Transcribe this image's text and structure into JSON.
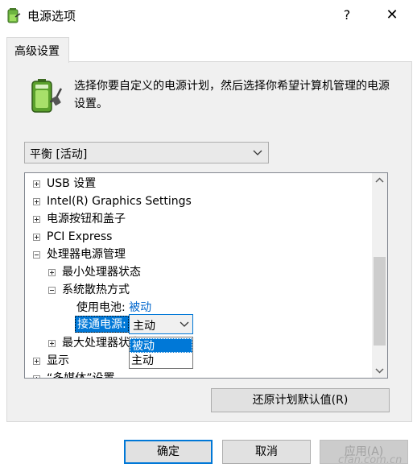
{
  "window": {
    "title": "电源选项",
    "help_label": "?",
    "close_label": "✕"
  },
  "tab": {
    "label": "高级设置"
  },
  "description": "选择你要自定义的电源计划，然后选择你希望计算机管理的电源设置。",
  "plan_select": {
    "value": "平衡 [活动]"
  },
  "tree": {
    "items": [
      {
        "label": "USB 设置",
        "expander": "plus"
      },
      {
        "label": "Intel(R) Graphics Settings",
        "expander": "plus"
      },
      {
        "label": "电源按钮和盖子",
        "expander": "plus"
      },
      {
        "label": "PCI Express",
        "expander": "plus"
      },
      {
        "label": "处理器电源管理",
        "expander": "minus"
      },
      {
        "label": "最小处理器状态",
        "expander": "plus"
      },
      {
        "label": "系统散热方式",
        "expander": "minus"
      },
      {
        "label": "使用电池:",
        "value": "被动"
      },
      {
        "label": "接通电源:",
        "value": "主动"
      },
      {
        "label": "最大处理器状态",
        "expander": "plus"
      },
      {
        "label": "显示",
        "expander": "plus"
      },
      {
        "label": "“多媒体”设置",
        "expander": "plus"
      }
    ]
  },
  "dropdown": {
    "options": [
      "被动",
      "主动"
    ],
    "selected": "被动"
  },
  "buttons": {
    "restore": "还原计划默认值(R)",
    "ok": "确定",
    "cancel": "取消",
    "apply": "应用(A)"
  },
  "watermark": "cfan.com.cn",
  "colors": {
    "accent": "#0078d7",
    "link": "#0066cc",
    "panel": "#f0f0f0"
  }
}
